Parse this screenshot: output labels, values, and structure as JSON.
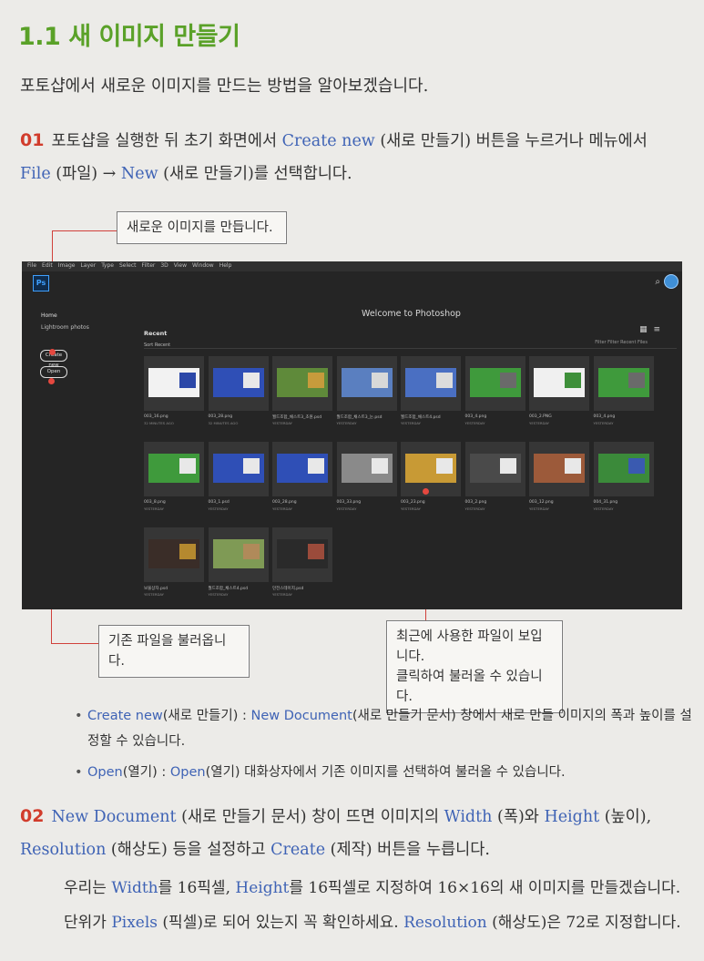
{
  "section_title": "1.1 새 이미지 만들기",
  "intro": "포토샵에서 새로운 이미지를 만드는 방법을 알아보겠습니다.",
  "step1": {
    "num": "01",
    "text_a": "포토샵을 실행한 뒤 초기 화면에서 ",
    "create_new": "Create new",
    "text_b": " (새로 만들기) 버튼을 누르거나 메뉴에서 ",
    "file": "File",
    "text_c": " (파일) → ",
    "new": "New",
    "text_d": " (새로 만들기)를 선택합니다."
  },
  "callouts": {
    "create": "새로운 이미지를 만듭니다.",
    "open": "기존 파일을 불러옵니다.",
    "recent_l1": "최근에 사용한 파일이 보입니다.",
    "recent_l2": "클릭하여 불러올 수 있습니다."
  },
  "photoshop": {
    "menu": [
      "File",
      "Edit",
      "Image",
      "Layer",
      "Type",
      "Select",
      "Filter",
      "3D",
      "View",
      "Window",
      "Help"
    ],
    "logo": "Ps",
    "welcome": "Welcome to Photoshop",
    "sidebar": {
      "home": "Home",
      "lightroom": "Lightroom photos",
      "create_new": "Create new",
      "open": "Open"
    },
    "recent_label": "Recent",
    "sort_label": "Sort  Recent",
    "filter_label": "Filter  Filter Recent Files",
    "search_icon": "⌕",
    "view_icons": "▦ ≡",
    "tiles": [
      {
        "name": "003_16.png",
        "meta": "32 MINUTES AGO",
        "color": "#f2f2f2",
        "accent": "#2c48a8"
      },
      {
        "name": "003_28.png",
        "meta": "32 MINUTES AGO",
        "color": "#2f4fb6",
        "accent": "#e8e8e8"
      },
      {
        "name": "월드조합_채스트3_초원.psd",
        "meta": "YESTERDAY",
        "color": "#5f8a3a",
        "accent": "#c79b3c"
      },
      {
        "name": "월드조합_채스트3_눈.psd",
        "meta": "YESTERDAY",
        "color": "#5a7fc0",
        "accent": "#d8d8d8"
      },
      {
        "name": "월드조합_채스트4.psd",
        "meta": "YESTERDAY",
        "color": "#4a6fc2",
        "accent": "#dcdcdc"
      },
      {
        "name": "003_4.png",
        "meta": "YESTERDAY",
        "color": "#3f9a3c",
        "accent": "#6a6a6a"
      },
      {
        "name": "003_2.PNG",
        "meta": "YESTERDAY",
        "color": "#f0f0f0",
        "accent": "#3e8f3a"
      },
      {
        "name": "003_4.png",
        "meta": "YESTERDAY",
        "color": "#3f9a3c",
        "accent": "#6a6a6a"
      },
      {
        "name": "003_8.png",
        "meta": "YESTERDAY",
        "color": "#3f9a3c",
        "accent": "#e8e8e8"
      },
      {
        "name": "003_1.psd",
        "meta": "YESTERDAY",
        "color": "#2f4fb6",
        "accent": "#e8e8e8"
      },
      {
        "name": "003_28.png",
        "meta": "YESTERDAY",
        "color": "#2f4fb6",
        "accent": "#e8e8e8"
      },
      {
        "name": "003_33.png",
        "meta": "YESTERDAY",
        "color": "#8a8a8a",
        "accent": "#e8e8e8"
      },
      {
        "name": "003_23.png",
        "meta": "YESTERDAY",
        "color": "#c89a35",
        "accent": "#e8e8e8"
      },
      {
        "name": "003_2.png",
        "meta": "YESTERDAY",
        "color": "#4a4a4a",
        "accent": "#e8e8e8"
      },
      {
        "name": "003_12.png",
        "meta": "YESTERDAY",
        "color": "#9c5a3a",
        "accent": "#e8e8e8"
      },
      {
        "name": "004_31.png",
        "meta": "YESTERDAY",
        "color": "#3b8a3a",
        "accent": "#3a5ab0"
      },
      {
        "name": "보물상자.psd",
        "meta": "YESTERDAY",
        "color": "#3a2d28",
        "accent": "#b5892f"
      },
      {
        "name": "월드조합_채스트4.psd",
        "meta": "YESTERDAY",
        "color": "#7f9a55",
        "accent": "#b08a5a"
      },
      {
        "name": "던전스테이지.psd",
        "meta": "YESTERDAY",
        "color": "#2a2a2a",
        "accent": "#9b4b3b"
      }
    ]
  },
  "bullets": {
    "b1_blue": "Create new",
    "b1_a": "(새로 만들기) : ",
    "b1_blue2": "New Document",
    "b1_b": "(새로 만들기 문서) 창에서 새로 만들 이미지의 폭과 높이를 설정할 수 있습니다.",
    "b2_blue": "Open",
    "b2_a": "(열기) : ",
    "b2_blue2": "Open",
    "b2_b": "(열기) 대화상자에서 기존 이미지를 선택하여 불러올 수 있습니다."
  },
  "step2": {
    "num": "02",
    "nd": "New Document",
    "t1": " (새로 만들기 문서) 창이 뜨면 이미지의 ",
    "width": "Width",
    "t2": " (폭)와 ",
    "height": "Height",
    "t3": " (높이), ",
    "resolution": "Resolution",
    "t4": " (해상도) 등을 설정하고 ",
    "create": "Create",
    "t5": " (제작) 버튼을 누릅니다."
  },
  "note": {
    "t1": "우리는 ",
    "width": "Width",
    "t2": "를 16픽셀, ",
    "height": "Height",
    "t3": "를 16픽셀로 지정하여 16×16의 새 이미지를 만들겠습니다. 단위가 ",
    "pixels": "Pixels",
    "t4": " (픽셀)로 되어 있는지 꼭 확인하세요. ",
    "resolution": "Resolution",
    "t5": " (해상도)은 72로 지정합니다."
  },
  "colors": {
    "title_green": "#5aa128",
    "step_red": "#d13c2c",
    "link_blue": "#3f63b5",
    "callout_line": "#d0403a"
  }
}
